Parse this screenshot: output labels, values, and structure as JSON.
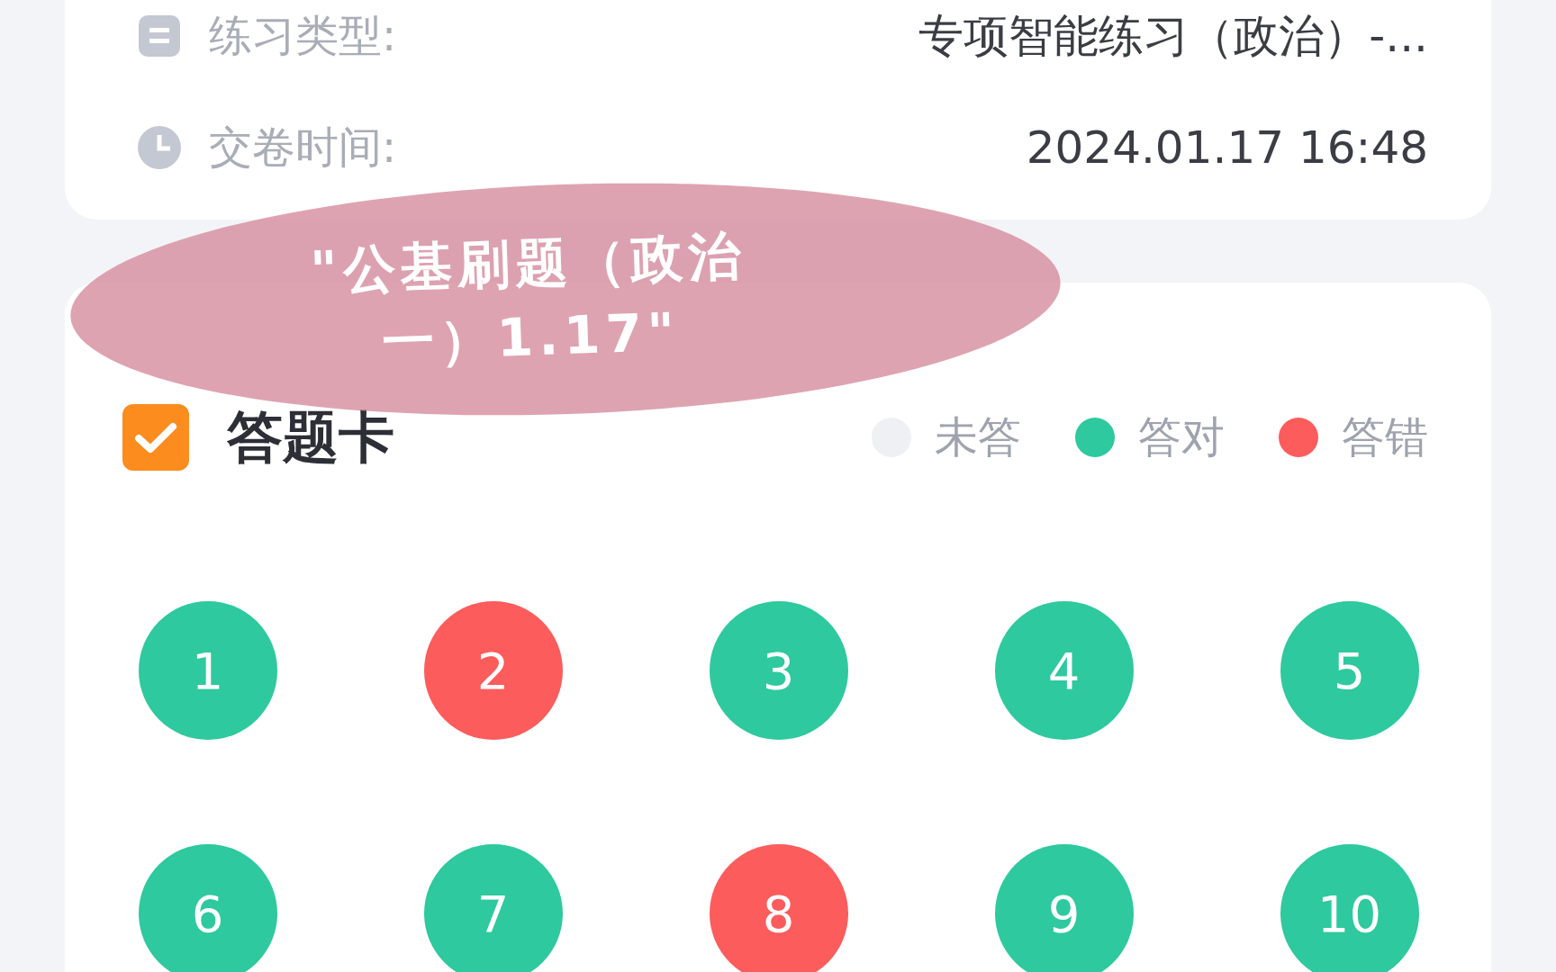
{
  "summary": {
    "rows": [
      {
        "kind": "type",
        "label": "练习类型:",
        "value": "专项智能练习（政治）-..."
      },
      {
        "kind": "time",
        "label": "交卷时间:",
        "value": "2024.01.17 16:48"
      }
    ]
  },
  "sticker": {
    "lines": [
      "\"公基刷题（政治",
      "一）1.17\""
    ]
  },
  "answer_card": {
    "title": "答题卡",
    "legend": [
      {
        "label": "未答",
        "color": "#eef0f4"
      },
      {
        "label": "答对",
        "color": "#2ec99e"
      },
      {
        "label": "答错",
        "color": "#fc5c5c"
      }
    ],
    "questions": [
      {
        "number": "1",
        "kind": "correct"
      },
      {
        "number": "2",
        "kind": "wrong"
      },
      {
        "number": "3",
        "kind": "correct"
      },
      {
        "number": "4",
        "kind": "correct"
      },
      {
        "number": "5",
        "kind": "correct"
      },
      {
        "number": "6",
        "kind": "correct"
      },
      {
        "number": "7",
        "kind": "correct"
      },
      {
        "number": "8",
        "kind": "wrong"
      },
      {
        "number": "9",
        "kind": "correct"
      },
      {
        "number": "10",
        "kind": "correct"
      }
    ]
  }
}
